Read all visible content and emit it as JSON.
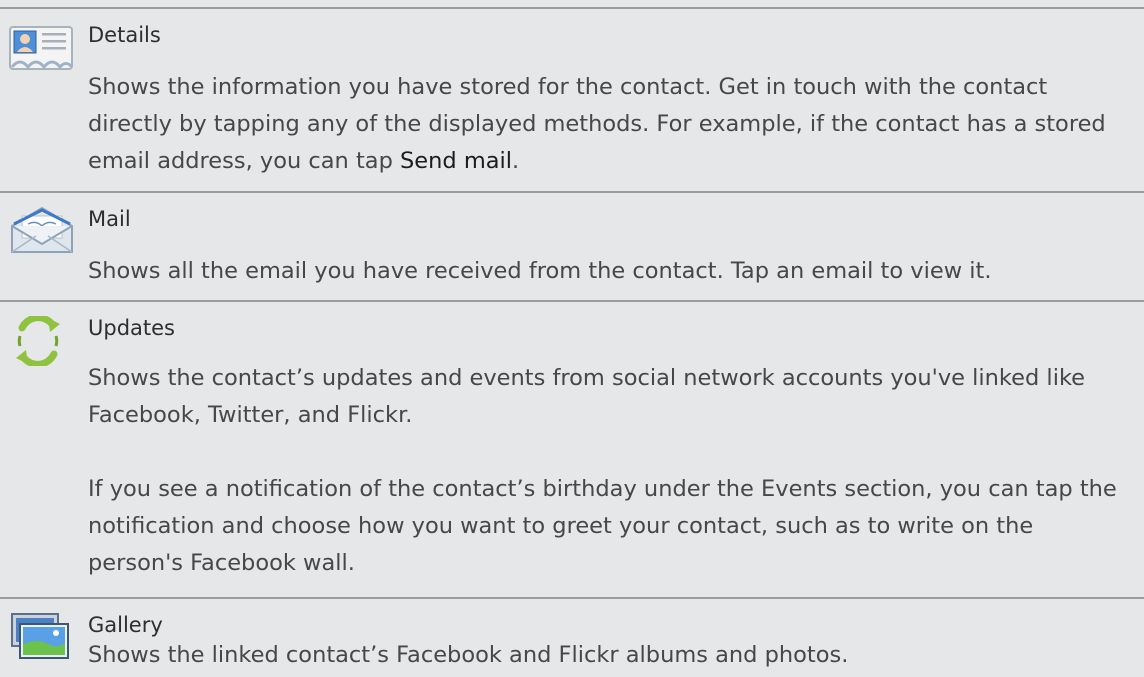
{
  "rows": [
    {
      "title": "Details",
      "icon": "contact-card-icon",
      "paragraphs": [
        {
          "before": "Shows the information you have stored for the contact. Get in touch with the contact directly by tapping any of the displayed methods. For example, if the contact has a stored email address, you can tap ",
          "emphasis": "Send mail",
          "after": "."
        }
      ]
    },
    {
      "title": "Mail",
      "icon": "envelope-icon",
      "paragraphs": [
        {
          "text": "Shows all the email you have received from the contact. Tap an email to view it."
        }
      ]
    },
    {
      "title": "Updates",
      "icon": "refresh-icon",
      "paragraphs": [
        {
          "text": "Shows the contact’s updates and events from social network accounts you've linked like Facebook, Twitter, and Flickr."
        },
        {
          "text": "If you see a notification of the contact’s birthday under the Events section, you can tap the notification and choose how you want to greet your contact, such as to write on the person's Facebook wall."
        }
      ]
    },
    {
      "title": "Gallery",
      "icon": "gallery-icon",
      "paragraphs": [
        {
          "text": "Shows the linked contact’s Facebook and Flickr albums and photos."
        }
      ]
    }
  ],
  "colors": {
    "background": "#e6e7e8",
    "rule": "#9c9c9c",
    "text": "#474747"
  }
}
